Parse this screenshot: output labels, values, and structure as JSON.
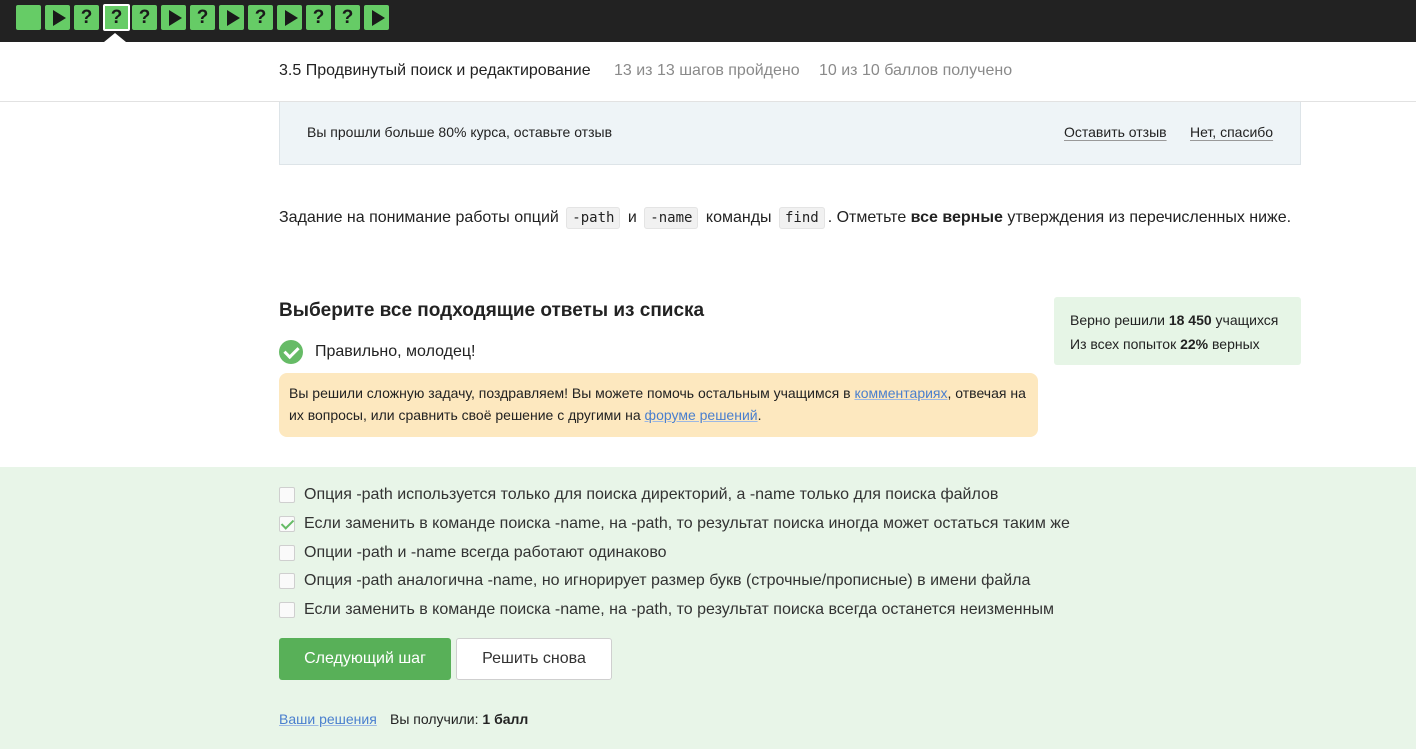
{
  "colors": {
    "topbar_bg": "#222222",
    "step_green": "#66cc66",
    "banner_bg": "#eef4f7",
    "hint_bg": "#fde8bf",
    "stats_bg": "#e6f5e6",
    "answers_bg": "#e8f5e8",
    "primary_button": "#58b058",
    "link": "#4a7fce"
  },
  "steps": [
    {
      "type": "blank",
      "icon": "square-icon"
    },
    {
      "type": "video",
      "icon": "play-icon"
    },
    {
      "type": "quiz",
      "icon": "question-icon",
      "label": "?"
    },
    {
      "type": "quiz",
      "icon": "question-icon",
      "label": "?",
      "active": true
    },
    {
      "type": "quiz",
      "icon": "question-icon",
      "label": "?"
    },
    {
      "type": "video",
      "icon": "play-icon"
    },
    {
      "type": "quiz",
      "icon": "question-icon",
      "label": "?"
    },
    {
      "type": "video",
      "icon": "play-icon"
    },
    {
      "type": "quiz",
      "icon": "question-icon",
      "label": "?"
    },
    {
      "type": "video",
      "icon": "play-icon"
    },
    {
      "type": "quiz",
      "icon": "question-icon",
      "label": "?"
    },
    {
      "type": "quiz",
      "icon": "question-icon",
      "label": "?"
    },
    {
      "type": "video",
      "icon": "play-icon"
    }
  ],
  "lesson": {
    "title": "3.5 Продвинутый поиск и редактирование",
    "steps_progress": "13 из 13 шагов пройдено",
    "score": "10 из 10 баллов  получено"
  },
  "banner": {
    "text": "Вы прошли больше 80% курса, оставьте отзыв",
    "leave_review": "Оставить отзыв",
    "no_thanks": "Нет, спасибо"
  },
  "task": {
    "part1": "Задание на понимание работы опций",
    "code_path": "-path",
    "and": "и",
    "code_name": "-name",
    "part2": "команды",
    "code_find": "find",
    "part3": ". Отметьте",
    "bold": "все верные",
    "part4": "утверждения из перечисленных ниже."
  },
  "question": {
    "title": "Выберите все подходящие ответы из списка",
    "correct_text": "Правильно, молодец!",
    "hint_part1": "Вы решили сложную задачу, поздравляем! Вы можете помочь остальным учащимся в",
    "hint_link1": "комментариях",
    "hint_part2": ", отвечая на их вопросы, или сравнить своё решение с другими на",
    "hint_link2": "форуме решений",
    "hint_part3": "."
  },
  "stats": {
    "solved_prefix": "Верно решили",
    "solved_count": "18 450",
    "solved_suffix": "учащихся",
    "attempts_prefix": "Из всех попыток",
    "attempts_percent": "22%",
    "attempts_suffix": "верных"
  },
  "options": [
    {
      "text": "Опция -path используется только для поиска директорий, а -name только для поиска файлов",
      "checked": false
    },
    {
      "text": "Если заменить в команде поиска -name, на -path, то результат поиска иногда может остаться таким же",
      "checked": true
    },
    {
      "text": "Опции -path и -name всегда работают одинаково",
      "checked": false
    },
    {
      "text": "Опция -path аналогична -name, но игнорирует размер букв (строчные/прописные) в имени файла",
      "checked": false
    },
    {
      "text": "Если заменить в команде поиска -name, на -path, то результат поиска всегда останется неизменным",
      "checked": false
    }
  ],
  "buttons": {
    "next": "Следующий шаг",
    "again": "Решить снова"
  },
  "footer": {
    "solutions_link": "Ваши решения",
    "result_prefix": "Вы получили:",
    "result_value": "1 балл"
  }
}
